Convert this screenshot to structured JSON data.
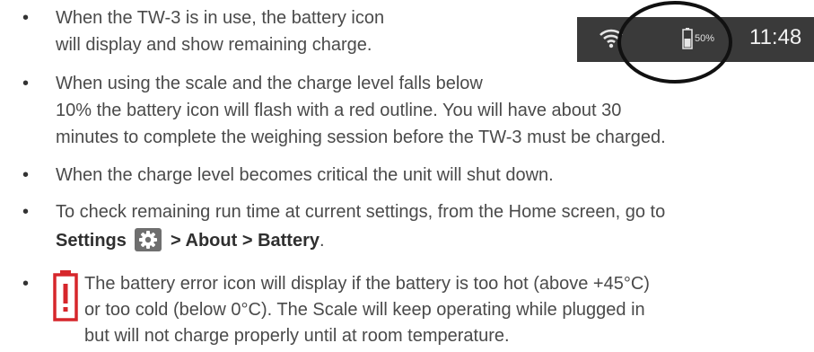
{
  "status_bar": {
    "battery_percent": "50%",
    "clock": "11:48",
    "background_color": "#3a3a3a",
    "icons": [
      "wifi-icon",
      "battery-icon"
    ]
  },
  "bullets": {
    "b1": {
      "line1": "When the TW-3 is in use, the battery icon",
      "line2": "will display and show remaining charge."
    },
    "b2": {
      "line1": "When using the scale and the charge level falls below",
      "line2": "10% the battery icon will flash with a red outline. You will have about 30",
      "line3": "minutes to complete the weighing session before the TW-3 must be charged."
    },
    "b3": {
      "line1": "When the charge level becomes critical the unit will shut down."
    },
    "b4": {
      "line1": "To check remaining run time at current settings, from the Home screen, go to",
      "settings_label": "Settings",
      "path_text": "> About > Battery",
      "period": "."
    },
    "b5": {
      "line1": "The battery error icon will display if the battery is too hot (above +45°C)",
      "line2": "or too cold (below 0°C). The Scale will keep operating while plugged in",
      "line3": "but will not charge properly until at room temperature."
    }
  },
  "bullet_char": "•",
  "colors": {
    "error_red": "#d6262b",
    "gear_background": "#6f6f6f"
  }
}
